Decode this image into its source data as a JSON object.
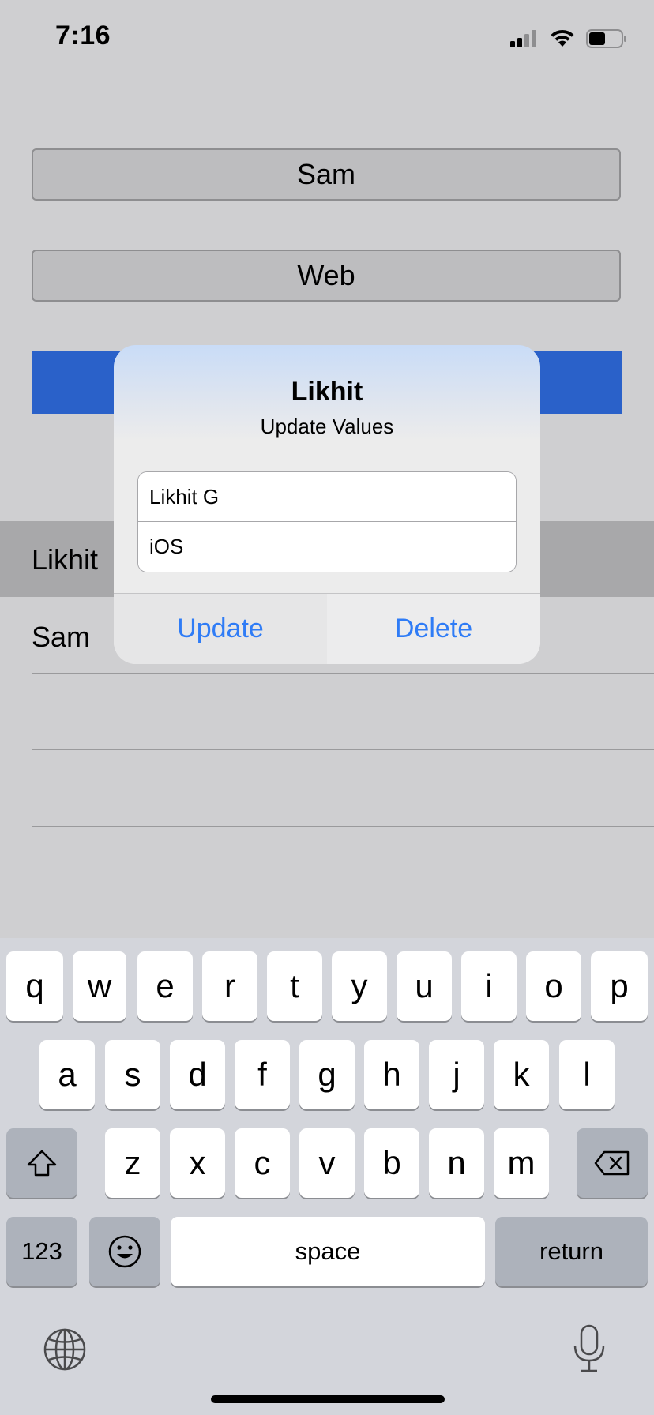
{
  "status_bar": {
    "time": "7:16"
  },
  "form": {
    "name_value": "Sam",
    "platform_value": "Web"
  },
  "list": {
    "rows": [
      "Likhit",
      "Sam"
    ]
  },
  "alert": {
    "title": "Likhit",
    "message": "Update Values",
    "name_field": "Likhit G",
    "platform_field": "iOS",
    "update_label": "Update",
    "delete_label": "Delete"
  },
  "keyboard": {
    "row1": [
      "q",
      "w",
      "e",
      "r",
      "t",
      "y",
      "u",
      "i",
      "o",
      "p"
    ],
    "row2": [
      "a",
      "s",
      "d",
      "f",
      "g",
      "h",
      "j",
      "k",
      "l"
    ],
    "row3": [
      "z",
      "x",
      "c",
      "v",
      "b",
      "n",
      "m"
    ],
    "numbers_label": "123",
    "space_label": "space",
    "return_label": "return"
  },
  "colors": {
    "accent": "#2f7cf6",
    "primary_button": "#2a61c9"
  }
}
